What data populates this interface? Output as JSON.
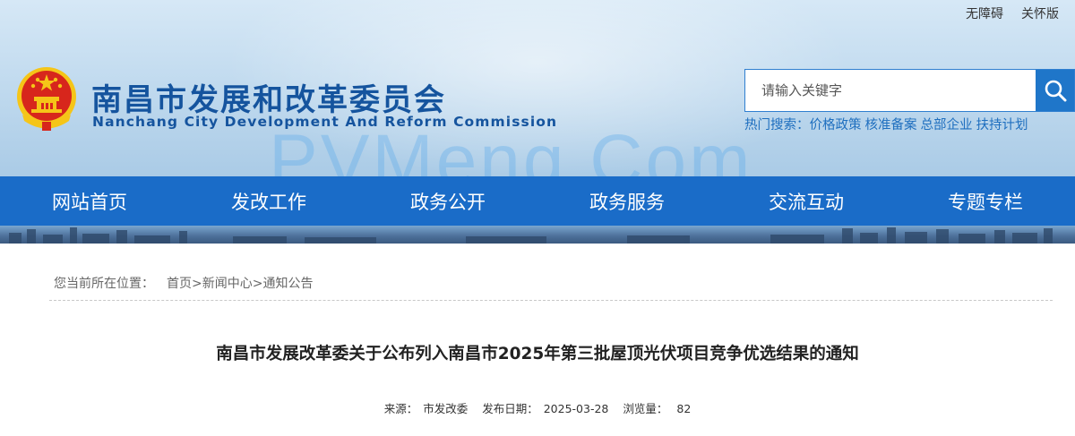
{
  "top_links": {
    "accessibility": "无障碍",
    "care_mode": "关怀版"
  },
  "site": {
    "title_cn": "南昌市发展和改革委员会",
    "title_en": "Nanchang City Development And Reform Commission"
  },
  "search": {
    "placeholder": "请输入关键字",
    "hot_label": "热门搜索：",
    "hot_items": [
      "价格政策",
      "核准备案",
      "总部企业",
      "扶持计划"
    ]
  },
  "watermark": "PVMeng.Com",
  "nav": [
    "网站首页",
    "发改工作",
    "政务公开",
    "政务服务",
    "交流互动",
    "专题专栏"
  ],
  "breadcrumb": {
    "prefix": "您当前所在位置：",
    "items": [
      "首页",
      "新闻中心",
      "通知公告"
    ],
    "separator": ">"
  },
  "article": {
    "title": "南昌市发展改革委关于公布列入南昌市2025年第三批屋顶光伏项目竞争优选结果的通知",
    "source_label": "来源：",
    "source": "市发改委",
    "date_label": "发布日期：",
    "date": "2025-03-28",
    "views_label": "浏览量：",
    "views": "82"
  },
  "colors": {
    "brand_blue": "#15549e",
    "nav_blue": "#1a6cc8",
    "link_blue": "#1f6fbf",
    "emblem_red": "#d7261c",
    "emblem_gold": "#f5c518"
  }
}
